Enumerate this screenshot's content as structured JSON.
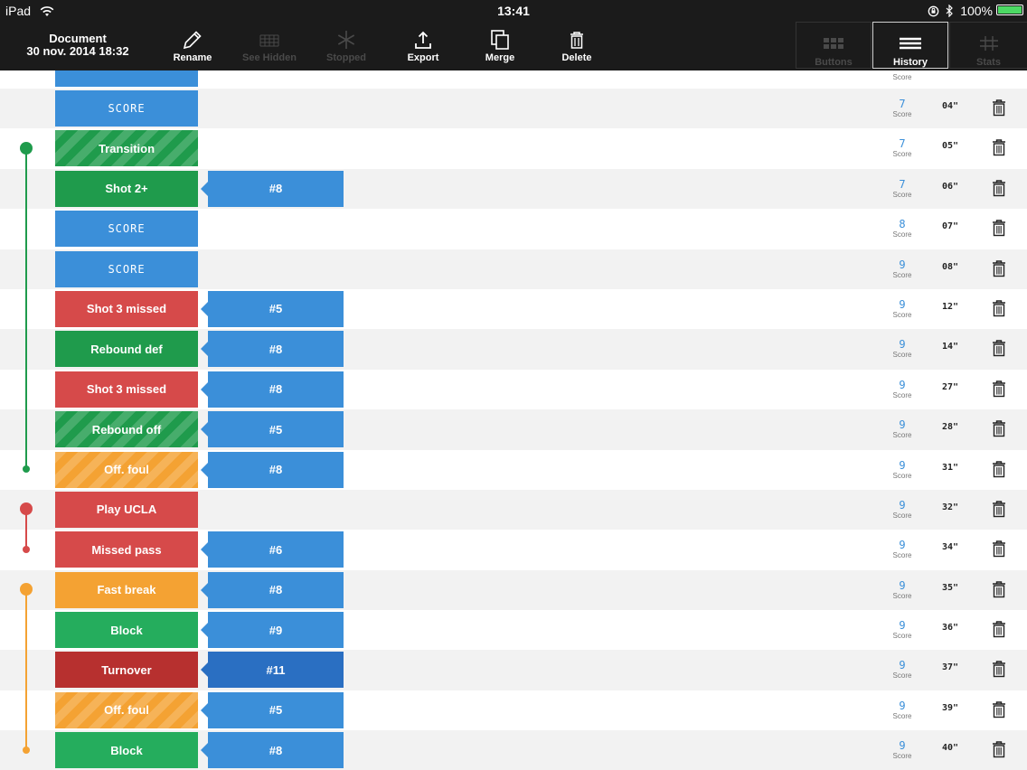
{
  "status_bar": {
    "device": "iPad",
    "time": "13:41",
    "battery": "100%"
  },
  "document": {
    "title": "Document",
    "date": "30 nov. 2014 18:32"
  },
  "toolbar": [
    {
      "name": "rename-button",
      "icon": "pencil-icon",
      "label": "Rename",
      "enabled": true
    },
    {
      "name": "see-hidden-button",
      "icon": "grid-icon",
      "label": "See Hidden",
      "enabled": false
    },
    {
      "name": "stopped-button",
      "icon": "snowflake-icon",
      "label": "Stopped",
      "enabled": false
    },
    {
      "name": "export-button",
      "icon": "export-icon",
      "label": "Export",
      "enabled": true
    },
    {
      "name": "merge-button",
      "icon": "merge-icon",
      "label": "Merge",
      "enabled": true
    },
    {
      "name": "delete-button",
      "icon": "trash-icon",
      "label": "Delete",
      "enabled": true
    }
  ],
  "view_tabs": [
    {
      "name": "tab-buttons",
      "icon": "buttons-icon",
      "label": "Buttons",
      "active": false
    },
    {
      "name": "tab-history",
      "icon": "list-icon",
      "label": "History",
      "active": true
    },
    {
      "name": "tab-stats",
      "icon": "hash-icon",
      "label": "Stats",
      "active": false
    }
  ],
  "colors": {
    "blue": "#3b8fd9",
    "dark_blue": "#2a6fc2",
    "green": "#1f9b4c",
    "light_green": "#25ad5d",
    "red": "#d64a4a",
    "dark_red": "#b7302f",
    "orange": "#f4a233"
  },
  "history": [
    {
      "action": "SCORE",
      "kind": "score",
      "color": "blue",
      "striped": false,
      "player": "",
      "score": "7",
      "score_label": "Score",
      "time": "04\""
    },
    {
      "action": "Transition",
      "kind": "action",
      "color": "green",
      "striped": true,
      "player": "",
      "score": "7",
      "score_label": "Score",
      "time": "05\""
    },
    {
      "action": "Shot 2+",
      "kind": "action",
      "color": "green",
      "striped": false,
      "player": "#8",
      "score": "7",
      "score_label": "Score",
      "time": "06\""
    },
    {
      "action": "SCORE",
      "kind": "score",
      "color": "blue",
      "striped": false,
      "player": "",
      "score": "8",
      "score_label": "Score",
      "time": "07\""
    },
    {
      "action": "SCORE",
      "kind": "score",
      "color": "blue",
      "striped": false,
      "player": "",
      "score": "9",
      "score_label": "Score",
      "time": "08\""
    },
    {
      "action": "Shot 3 missed",
      "kind": "action",
      "color": "red",
      "striped": false,
      "player": "#5",
      "score": "9",
      "score_label": "Score",
      "time": "12\""
    },
    {
      "action": "Rebound def",
      "kind": "action",
      "color": "green",
      "striped": false,
      "player": "#8",
      "score": "9",
      "score_label": "Score",
      "time": "14\""
    },
    {
      "action": "Shot 3 missed",
      "kind": "action",
      "color": "red",
      "striped": false,
      "player": "#8",
      "score": "9",
      "score_label": "Score",
      "time": "27\""
    },
    {
      "action": "Rebound off",
      "kind": "action",
      "color": "green",
      "striped": true,
      "player": "#5",
      "score": "9",
      "score_label": "Score",
      "time": "28\""
    },
    {
      "action": "Off. foul",
      "kind": "action",
      "color": "orange",
      "striped": true,
      "player": "#8",
      "score": "9",
      "score_label": "Score",
      "time": "31\""
    },
    {
      "action": "Play UCLA",
      "kind": "action",
      "color": "red",
      "striped": false,
      "player": "",
      "score": "9",
      "score_label": "Score",
      "time": "32\""
    },
    {
      "action": "Missed pass",
      "kind": "action",
      "color": "red",
      "striped": false,
      "player": "#6",
      "score": "9",
      "score_label": "Score",
      "time": "34\""
    },
    {
      "action": "Fast break",
      "kind": "action",
      "color": "orange",
      "striped": false,
      "player": "#8",
      "score": "9",
      "score_label": "Score",
      "time": "35\""
    },
    {
      "action": "Block",
      "kind": "action",
      "color": "light_green",
      "striped": false,
      "player": "#9",
      "score": "9",
      "score_label": "Score",
      "time": "36\""
    },
    {
      "action": "Turnover",
      "kind": "action",
      "color": "dark_red",
      "striped": false,
      "player": "#11",
      "player_color": "dark_blue",
      "score": "9",
      "score_label": "Score",
      "time": "37\""
    },
    {
      "action": "Off. foul",
      "kind": "action",
      "color": "orange",
      "striped": true,
      "player": "#5",
      "score": "9",
      "score_label": "Score",
      "time": "39\""
    },
    {
      "action": "Block",
      "kind": "action",
      "color": "light_green",
      "striped": false,
      "player": "#8",
      "score": "9",
      "score_label": "Score",
      "time": "40\""
    }
  ]
}
